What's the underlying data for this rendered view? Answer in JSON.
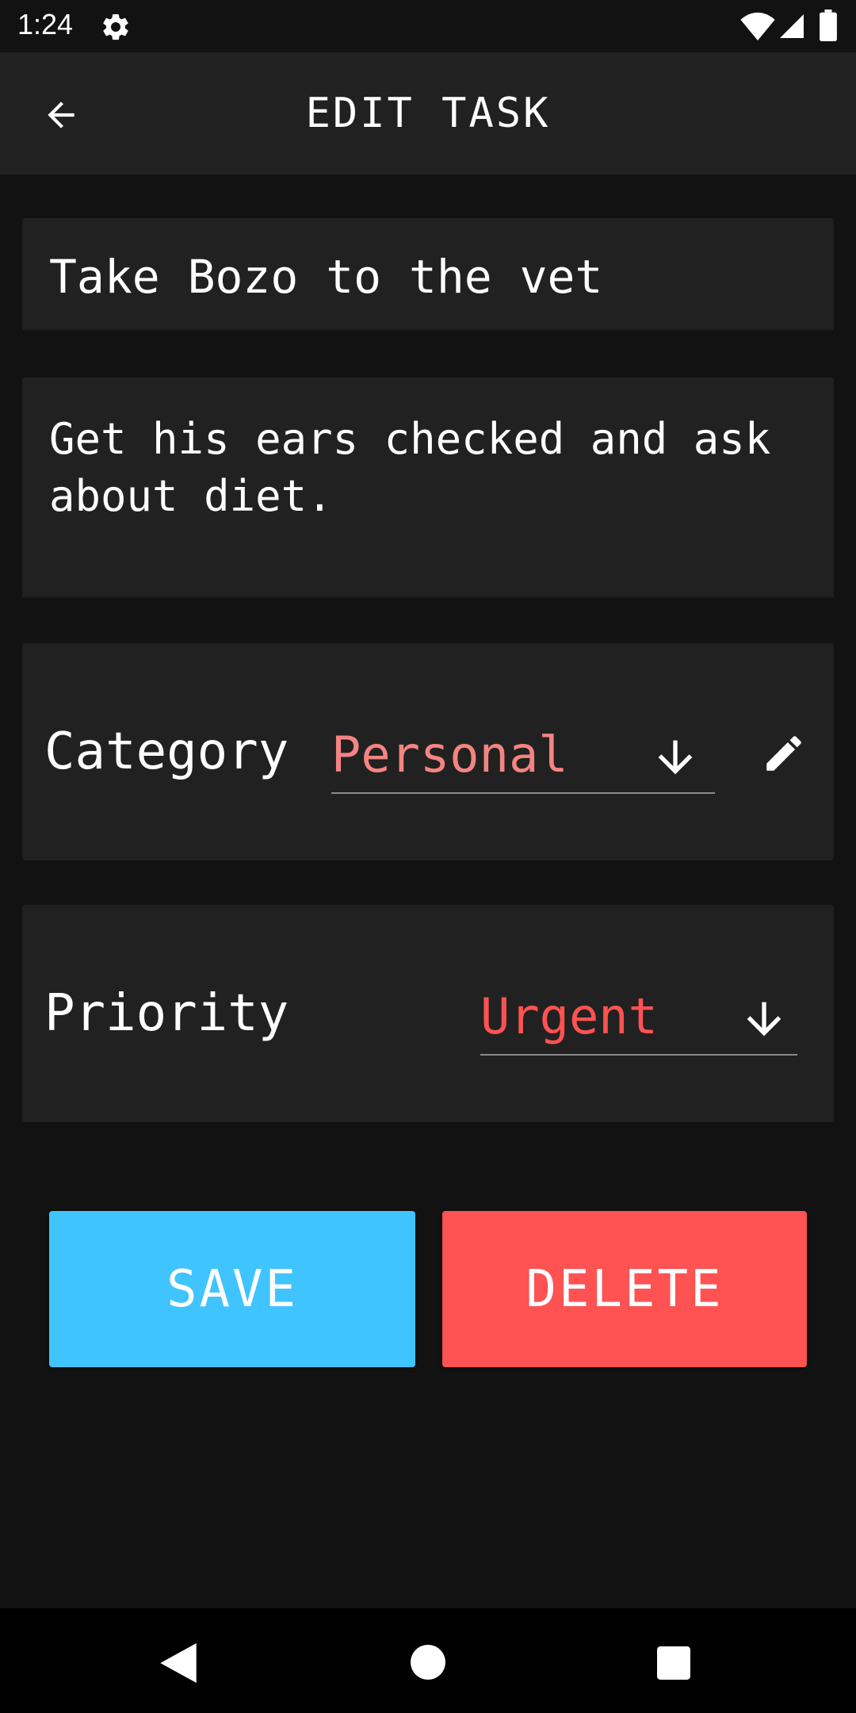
{
  "status_bar": {
    "time": "1:24",
    "icons": [
      "settings-gear-icon",
      "wifi-icon",
      "cell-signal-icon",
      "battery-icon"
    ]
  },
  "toolbar": {
    "title": "EDIT TASK",
    "back_icon": "arrow-back-icon"
  },
  "task": {
    "title": "Take Bozo to the vet",
    "description": "Get his ears checked and ask about diet."
  },
  "category": {
    "label": "Category",
    "value": "Personal",
    "dropdown_icon": "arrow-down-icon",
    "edit_icon": "pencil-icon"
  },
  "priority": {
    "label": "Priority",
    "value": "Urgent",
    "dropdown_icon": "arrow-down-icon"
  },
  "actions": {
    "save_label": "SAVE",
    "delete_label": "DELETE"
  },
  "nav_bar": {
    "icons": [
      "nav-back-icon",
      "nav-home-icon",
      "nav-recents-icon"
    ]
  },
  "colors": {
    "background": "#121212",
    "surface": "#212121",
    "save": "#40c4ff",
    "delete": "#ff5252",
    "category_value": "#f48482",
    "priority_value": "#ff5252"
  }
}
